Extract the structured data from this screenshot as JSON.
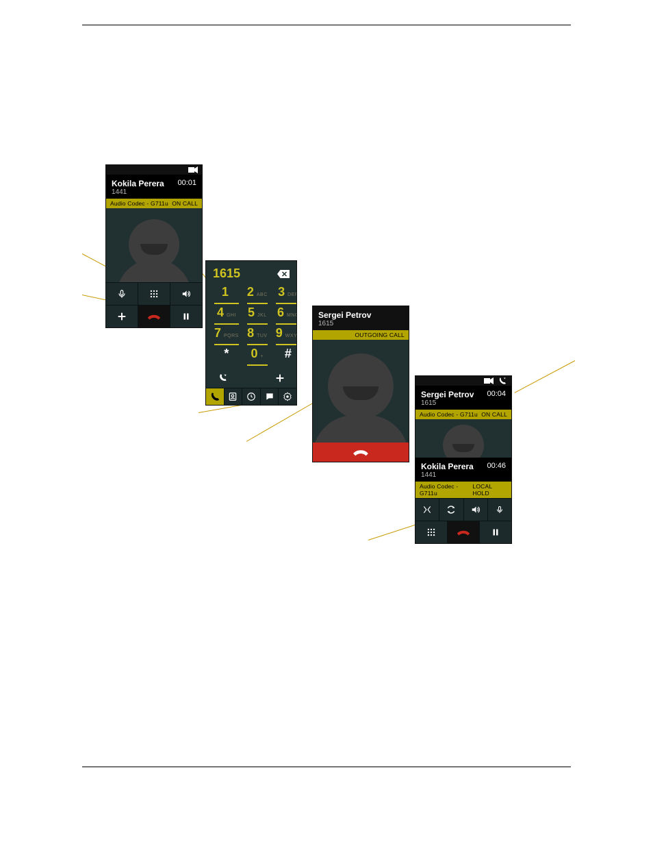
{
  "phone1": {
    "caller_name": "Kokila Perera",
    "caller_ext": "1441",
    "timer": "00:01",
    "codec_label": "Audio Codec - G711u",
    "status": "ON CALL"
  },
  "phone2": {
    "typed_number": "1615",
    "keys": [
      {
        "d": "1",
        "l": ""
      },
      {
        "d": "2",
        "l": "ABC"
      },
      {
        "d": "3",
        "l": "DEF"
      },
      {
        "d": "4",
        "l": "GHI"
      },
      {
        "d": "5",
        "l": "JKL"
      },
      {
        "d": "6",
        "l": "MNO"
      },
      {
        "d": "7",
        "l": "PQRS"
      },
      {
        "d": "8",
        "l": "TUV"
      },
      {
        "d": "9",
        "l": "WXYZ"
      },
      {
        "d": "*",
        "l": ""
      },
      {
        "d": "0",
        "l": "+"
      },
      {
        "d": "#",
        "l": ""
      }
    ]
  },
  "phone3": {
    "caller_name": "Sergei Petrov",
    "caller_ext": "1615",
    "status": "OUTGOING CALL"
  },
  "phone4": {
    "call1_name": "Sergei Petrov",
    "call1_ext": "1615",
    "call1_timer": "00:04",
    "call1_codec": "Audio Codec - G711u",
    "call1_status": "ON CALL",
    "call2_name": "Kokila Perera",
    "call2_ext": "1441",
    "call2_timer": "00:46",
    "call2_codec": "Audio Codec - G711u",
    "call2_status": "LOCAL HOLD"
  }
}
